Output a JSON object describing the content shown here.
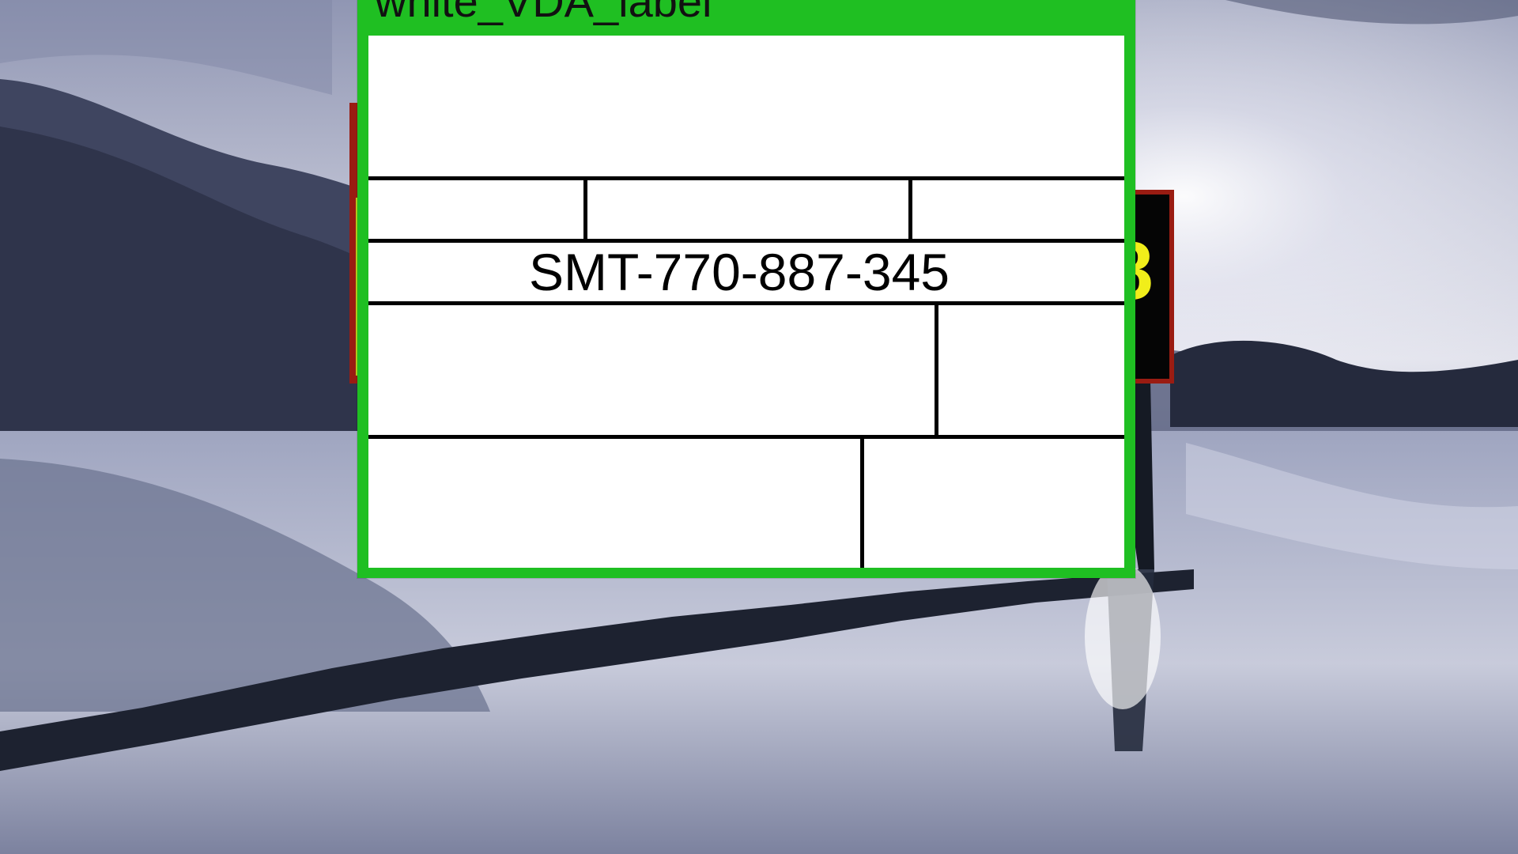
{
  "window": {
    "title": "white_VDA_label"
  },
  "label": {
    "tracking_number": "SMT-770-887-345"
  },
  "colors": {
    "window_frame": "#1fbf22",
    "label_background": "#ffffff",
    "label_lines": "#000000",
    "background_window_border": "#9a1c12",
    "background_window_accent": "#f1ee1a"
  },
  "icons": {
    "background_scene": "lake-landscape-photo"
  }
}
